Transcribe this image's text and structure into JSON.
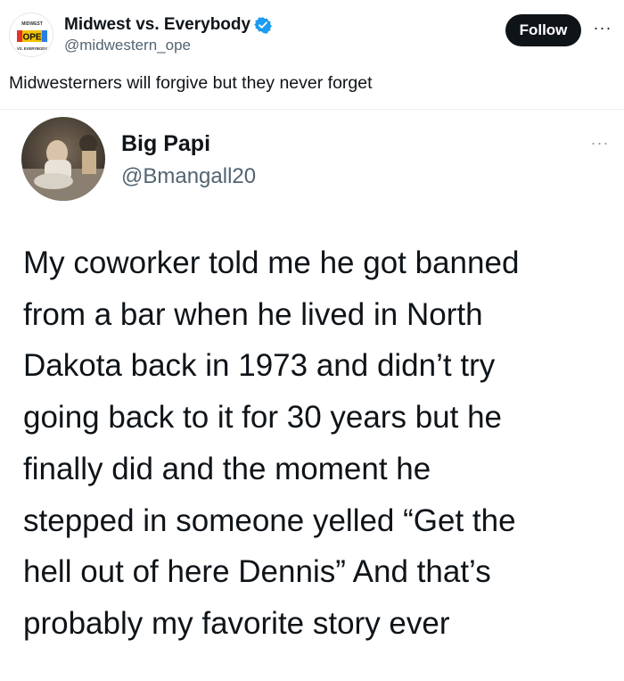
{
  "post": {
    "author_name": "Midwest vs. Everybody",
    "author_handle": "@midwestern_ope",
    "logo_text_top": "MIDWEST",
    "logo_text_center": "OPE",
    "logo_text_bottom": "VS. EVERYBODY",
    "follow_label": "Follow",
    "more_label": "···",
    "text": "Midwesterners will forgive but they never forget",
    "colors": {
      "follow_bg": "#0f1419",
      "verified": "#1d9bf0",
      "handle": "#536471"
    }
  },
  "embedded_post": {
    "author_name": "Big Papi",
    "author_handle": "@Bmangall20",
    "more_label": "···",
    "lines": [
      "My coworker told me he got banned",
      "from a bar when he lived in North",
      "Dakota back in 1973 and didn’t try",
      "going back to it for 30 years but he",
      "finally did and the moment he",
      "stepped in someone yelled “Get the",
      "hell out of here Dennis” And that’s",
      "probably my favorite story ever"
    ]
  }
}
